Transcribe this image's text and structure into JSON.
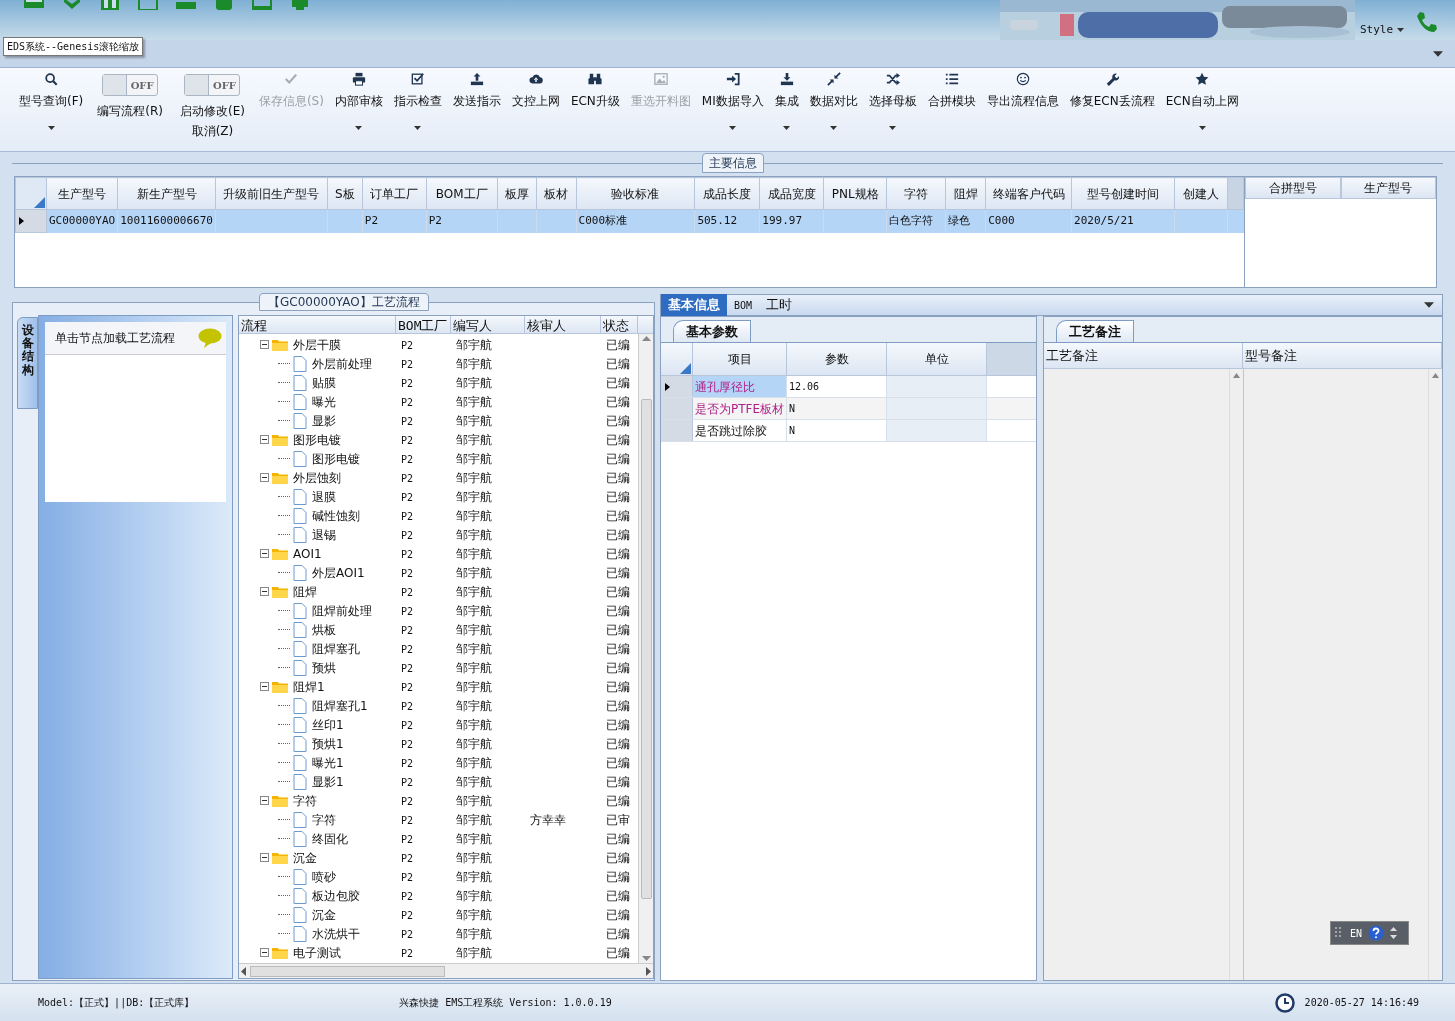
{
  "top_bar": {
    "style_menu": "Style"
  },
  "tooltip": "EDS系统--Genesis滚轮缩放",
  "ribbon": [
    {
      "kind": "button",
      "label": "型号查询(F)",
      "menu": true,
      "disabled": false
    },
    {
      "kind": "toggle",
      "label": "编写流程(R)",
      "switch_text": "OFF",
      "on": false
    },
    {
      "kind": "toggle",
      "label": "启动修改(E)",
      "sub_label": "取消(Z)",
      "switch_text": "OFF",
      "on": false
    },
    {
      "kind": "button",
      "label": "保存信息(S)",
      "menu": false,
      "disabled": true
    },
    {
      "kind": "button",
      "label": "内部审核",
      "menu": true,
      "disabled": false
    },
    {
      "kind": "button",
      "label": "指示检查",
      "menu": true,
      "disabled": false
    },
    {
      "kind": "button",
      "label": "发送指示",
      "menu": false,
      "disabled": false
    },
    {
      "kind": "button",
      "label": "文控上网",
      "menu": false,
      "disabled": false
    },
    {
      "kind": "button",
      "label": "ECN升级",
      "menu": false,
      "disabled": false
    },
    {
      "kind": "button",
      "label": "重选开料图",
      "menu": false,
      "disabled": true
    },
    {
      "kind": "button",
      "label": "MI数据导入",
      "menu": true,
      "disabled": false
    },
    {
      "kind": "button",
      "label": "集成",
      "menu": true,
      "disabled": false
    },
    {
      "kind": "button",
      "label": "数据对比",
      "menu": true,
      "disabled": false
    },
    {
      "kind": "button",
      "label": "选择母板",
      "menu": true,
      "disabled": false
    },
    {
      "kind": "button",
      "label": "合拼模块",
      "menu": false,
      "disabled": false
    },
    {
      "kind": "button",
      "label": "导出流程信息",
      "menu": false,
      "disabled": false
    },
    {
      "kind": "button",
      "label": "修复ECN丢流程",
      "menu": false,
      "disabled": false
    },
    {
      "kind": "button",
      "label": "ECN自动上网",
      "menu": true,
      "disabled": false
    }
  ],
  "main_info": {
    "title": "主要信息",
    "columns": [
      "生产型号",
      "新生产型号",
      "升级前旧生产型号",
      "S板",
      "订单工厂",
      "BOM工厂",
      "板厚",
      "板材",
      "验收标准",
      "成品长度",
      "成品宽度",
      "PNL规格",
      "字符",
      "阻焊",
      "终端客户代码",
      "型号创建时间",
      "创建人"
    ],
    "rows": [
      {
        "selected": true,
        "cells": [
          "GC00000YAO",
          "10011600006670",
          null,
          null,
          "P2",
          "P2",
          null,
          null,
          "C000标准",
          "505.12",
          "199.97",
          null,
          "白色字符",
          "绿色",
          "C000",
          "2020/5/21",
          null
        ]
      }
    ],
    "side_columns": [
      "合拼型号",
      "生产型号"
    ]
  },
  "process": {
    "title": "【GC00000YAO】工艺流程",
    "side_tab": "设备结构",
    "hint": "单击节点加载工艺流程",
    "columns": [
      "流程",
      "BOM工厂",
      "编写人",
      "核审人",
      "状态"
    ],
    "nodes": [
      {
        "label": "外层干膜",
        "bom": "P2",
        "writer": "邹宇航",
        "status": "已编",
        "expanded": true,
        "children": [
          {
            "label": "外层前处理",
            "bom": "P2",
            "writer": "邹宇航",
            "status": "已编"
          },
          {
            "label": "贴膜",
            "bom": "P2",
            "writer": "邹宇航",
            "status": "已编"
          },
          {
            "label": "曝光",
            "bom": "P2",
            "writer": "邹宇航",
            "status": "已编"
          },
          {
            "label": "显影",
            "bom": "P2",
            "writer": "邹宇航",
            "status": "已编"
          }
        ]
      },
      {
        "label": "图形电镀",
        "bom": "P2",
        "writer": "邹宇航",
        "status": "已编",
        "expanded": true,
        "children": [
          {
            "label": "图形电镀",
            "bom": "P2",
            "writer": "邹宇航",
            "status": "已编"
          }
        ]
      },
      {
        "label": "外层蚀刻",
        "bom": "P2",
        "writer": "邹宇航",
        "status": "已编",
        "expanded": true,
        "children": [
          {
            "label": "退膜",
            "bom": "P2",
            "writer": "邹宇航",
            "status": "已编"
          },
          {
            "label": "碱性蚀刻",
            "bom": "P2",
            "writer": "邹宇航",
            "status": "已编"
          },
          {
            "label": "退锡",
            "bom": "P2",
            "writer": "邹宇航",
            "status": "已编"
          }
        ]
      },
      {
        "label": "AOI1",
        "bom": "P2",
        "writer": "邹宇航",
        "status": "已编",
        "expanded": true,
        "children": [
          {
            "label": "外层AOI1",
            "bom": "P2",
            "writer": "邹宇航",
            "status": "已编"
          }
        ]
      },
      {
        "label": "阻焊",
        "bom": "P2",
        "writer": "邹宇航",
        "status": "已编",
        "expanded": true,
        "children": [
          {
            "label": "阻焊前处理",
            "bom": "P2",
            "writer": "邹宇航",
            "status": "已编"
          },
          {
            "label": "烘板",
            "bom": "P2",
            "writer": "邹宇航",
            "status": "已编"
          },
          {
            "label": "阻焊塞孔",
            "bom": "P2",
            "writer": "邹宇航",
            "status": "已编"
          },
          {
            "label": "预烘",
            "bom": "P2",
            "writer": "邹宇航",
            "status": "已编"
          }
        ]
      },
      {
        "label": "阻焊1",
        "bom": "P2",
        "writer": "邹宇航",
        "status": "已编",
        "expanded": true,
        "children": [
          {
            "label": "阻焊塞孔1",
            "bom": "P2",
            "writer": "邹宇航",
            "status": "已编"
          },
          {
            "label": "丝印1",
            "bom": "P2",
            "writer": "邹宇航",
            "status": "已编"
          },
          {
            "label": "预烘1",
            "bom": "P2",
            "writer": "邹宇航",
            "status": "已编"
          },
          {
            "label": "曝光1",
            "bom": "P2",
            "writer": "邹宇航",
            "status": "已编"
          },
          {
            "label": "显影1",
            "bom": "P2",
            "writer": "邹宇航",
            "status": "已编"
          }
        ]
      },
      {
        "label": "字符",
        "bom": "P2",
        "writer": "邹宇航",
        "status": "已编",
        "expanded": true,
        "children": [
          {
            "label": "字符",
            "bom": "P2",
            "writer": "邹宇航",
            "reviewer": "方幸幸",
            "status": "已审"
          },
          {
            "label": "终固化",
            "bom": "P2",
            "writer": "邹宇航",
            "status": "已编"
          }
        ]
      },
      {
        "label": "沉金",
        "bom": "P2",
        "writer": "邹宇航",
        "status": "已编",
        "expanded": true,
        "children": [
          {
            "label": "喷砂",
            "bom": "P2",
            "writer": "邹宇航",
            "status": "已编"
          },
          {
            "label": "板边包胶",
            "bom": "P2",
            "writer": "邹宇航",
            "status": "已编"
          },
          {
            "label": "沉金",
            "bom": "P2",
            "writer": "邹宇航",
            "status": "已编"
          },
          {
            "label": "水洗烘干",
            "bom": "P2",
            "writer": "邹宇航",
            "status": "已编"
          }
        ]
      },
      {
        "label": "电子测试",
        "bom": "P2",
        "writer": "邹宇航",
        "status": "已编",
        "expanded": true
      }
    ]
  },
  "detail": {
    "tabs": [
      {
        "label": "基本信息",
        "selected": true
      },
      {
        "label": "BOM",
        "selected": false
      },
      {
        "label": "工时",
        "selected": false
      }
    ],
    "params": {
      "tab": "基本参数",
      "columns": [
        "项目",
        "参数",
        "单位"
      ],
      "rows": [
        {
          "item": "通孔厚径比",
          "value": "12.06",
          "flagged": true,
          "selected": true
        },
        {
          "item": "是否为PTFE板材",
          "value": "N",
          "flagged": true,
          "selected": false
        },
        {
          "item": "是否跳过除胶",
          "value": "N",
          "flagged": false,
          "selected": false
        }
      ]
    },
    "notes": {
      "tab": "工艺备注",
      "columns": [
        "工艺备注",
        "型号备注"
      ]
    }
  },
  "language_bar": {
    "label": "EN"
  },
  "status_bar": {
    "mode": "Model:【正式】||DB:【正式库】",
    "app": "兴森快捷 EMS工程系统 Version: 1.0.0.19",
    "time": "2020-05-27 14:16:49"
  }
}
